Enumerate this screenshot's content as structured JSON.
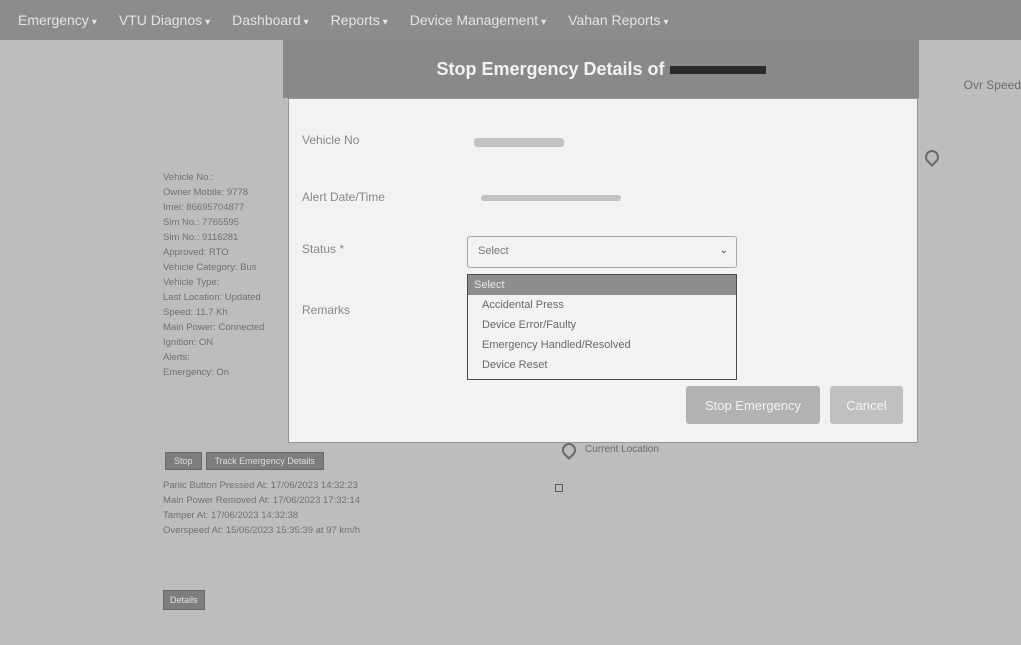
{
  "navbar": {
    "items": [
      {
        "label": "Emergency",
        "caret": "▾"
      },
      {
        "label": "VTU Diagnos",
        "caret": "▾"
      },
      {
        "label": "Dashboard",
        "caret": "▾"
      },
      {
        "label": "Reports",
        "caret": "▾"
      },
      {
        "label": "Device Management",
        "caret": "▾"
      },
      {
        "label": "Vahan Reports",
        "caret": "▾"
      }
    ]
  },
  "background": {
    "right_text": "Ovr Speed",
    "details_lines": [
      "Vehicle No.: ",
      "Owner Mobile: 9778",
      "Imei: 86695704877",
      "Sim No.: 7765595",
      "Sim No.: 9116281",
      "Approved: RTO",
      "Vehicle Category: Bus",
      "Vehicle Type: ",
      "Last Location: Updated",
      "Speed: 11.7 Kh",
      "Main Power: Connected",
      "Ignition: ON",
      "Alerts: ",
      "Emergency: On"
    ],
    "buttons": [
      "Stop",
      "Track Emergency Details"
    ],
    "details_lines2": [
      "Panic Button Pressed At: 17/06/2023 14:32:23",
      "Main Power Removed At: 17/06/2023 17:32:14",
      "Tamper At: 17/06/2023 14:32:38",
      "Overspeed At: 15/06/2023 15:35:39 at 97 km/h"
    ],
    "small_button": "Details",
    "map_label": "Current Location"
  },
  "modal": {
    "title_prefix": "Stop Emergency Details of",
    "fields": {
      "vehicle_no_label": "Vehicle No",
      "alert_datetime_label": "Alert Date/Time",
      "status_label": "Status *",
      "remarks_label": "Remarks"
    },
    "select": {
      "value": "Select",
      "chevron": "⌄"
    },
    "options": [
      {
        "label": "Select",
        "selected": true
      },
      {
        "label": "Accidental Press"
      },
      {
        "label": "Device Error/Faulty"
      },
      {
        "label": "Emergency Handled/Resolved"
      },
      {
        "label": "Device Reset"
      }
    ],
    "buttons": {
      "stop": "Stop Emergency",
      "cancel": "Cancel"
    }
  },
  "colors": {
    "overlay": "#bdbdbd",
    "header": "#8a8a8a",
    "selected_option": "#8f8f8f"
  },
  "icons": {
    "map_marker": "map-marker-icon",
    "chevron": "chevron-down-icon"
  }
}
